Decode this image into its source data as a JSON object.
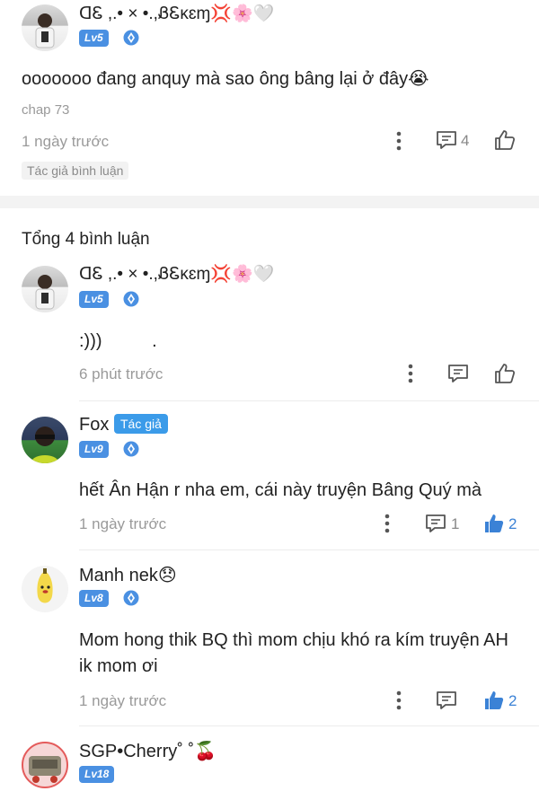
{
  "top_comment": {
    "user_name": "ᗡᏋ ,.• × •.,ᏰᏋκɛɱ💢🌸🤍",
    "level": "Lv5",
    "text": "ooooooo đang anquy mà sao ông bâng lại ở đây😭",
    "chapter": "chap 73",
    "time": "1 ngày trước",
    "reply_count": "4",
    "tag": "Tác giả bình luận"
  },
  "replies_header": "Tổng 4 bình luận",
  "replies": [
    {
      "user_name": "ᗡᏋ ,.• × •.,ᏰᏋκɛɱ💢🌸🤍",
      "level": "Lv5",
      "text": ":)))          .",
      "time": "6 phút trước",
      "reply_count": "",
      "like_count": "",
      "liked": false
    },
    {
      "user_name": "Fox",
      "author_badge": "Tác giả",
      "level": "Lv9",
      "text": "hết Ân Hận r nha em, cái này truyện Bâng Quý mà",
      "time": "1 ngày trước",
      "reply_count": "1",
      "like_count": "2",
      "liked": true
    },
    {
      "user_name": "Manh nek😞",
      "level": "Lv8",
      "text_line1": "Mom hong thik BQ thì mom chịu khó ra kím truyện AH",
      "text_line2": "ik mom ơi",
      "time": "1 ngày trước",
      "reply_count": "",
      "like_count": "2",
      "liked": true
    },
    {
      "user_name": "SGP•Cherry˚ ˚🍒",
      "level": "Lv18"
    }
  ],
  "colors": {
    "accent": "#3b82d6",
    "level_badge": "#4a90e2",
    "author_badge": "#3b9be9",
    "muted": "#9a9a9a"
  },
  "icons": [
    "more-vertical-icon",
    "reply-icon",
    "like-icon",
    "liked-icon",
    "level-crest-icon"
  ]
}
